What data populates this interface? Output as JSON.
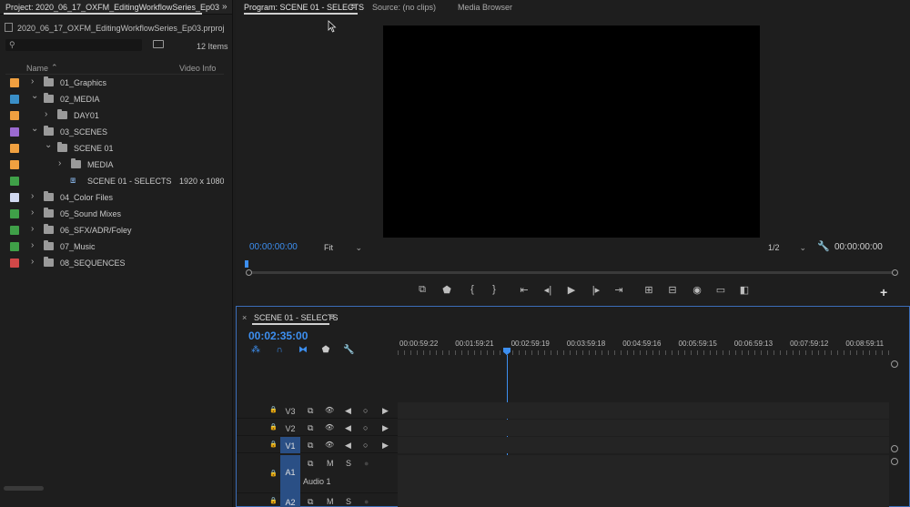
{
  "project": {
    "tab_title": "Project: 2020_06_17_OXFM_EditingWorkflowSeries_Ep03",
    "file_name": "2020_06_17_OXFM_EditingWorkflowSeries_Ep03.prproj",
    "item_count": "12 Items",
    "columns": {
      "name": "Name",
      "video_info": "Video Info"
    },
    "items": [
      {
        "name": "01_Graphics",
        "color": "#f0a040",
        "indent": 0,
        "type": "bin",
        "expanded": false,
        "video_info": ""
      },
      {
        "name": "02_MEDIA",
        "color": "#3a8fc8",
        "indent": 0,
        "type": "bin",
        "expanded": true,
        "video_info": ""
      },
      {
        "name": "DAY01",
        "color": "#f0a040",
        "indent": 1,
        "type": "bin",
        "expanded": false,
        "video_info": ""
      },
      {
        "name": "03_SCENES",
        "color": "#9b6ad0",
        "indent": 0,
        "type": "bin",
        "expanded": true,
        "video_info": ""
      },
      {
        "name": "SCENE 01",
        "color": "#f0a040",
        "indent": 1,
        "type": "bin",
        "expanded": true,
        "video_info": ""
      },
      {
        "name": "MEDIA",
        "color": "#f0a040",
        "indent": 2,
        "type": "bin",
        "expanded": false,
        "video_info": ""
      },
      {
        "name": "SCENE 01 - SELECTS",
        "color": "#3fa048",
        "indent": 2,
        "type": "sequence",
        "expanded": false,
        "video_info": "1920 x 1080 ("
      },
      {
        "name": "04_Color Files",
        "color": "#d0d8f0",
        "indent": 0,
        "type": "bin",
        "expanded": false,
        "video_info": ""
      },
      {
        "name": "05_Sound Mixes",
        "color": "#3fa048",
        "indent": 0,
        "type": "bin",
        "expanded": false,
        "video_info": ""
      },
      {
        "name": "06_SFX/ADR/Foley",
        "color": "#3fa048",
        "indent": 0,
        "type": "bin",
        "expanded": false,
        "video_info": ""
      },
      {
        "name": "07_Music",
        "color": "#3fa048",
        "indent": 0,
        "type": "bin",
        "expanded": false,
        "video_info": ""
      },
      {
        "name": "08_SEQUENCES",
        "color": "#d04848",
        "indent": 0,
        "type": "bin",
        "expanded": false,
        "video_info": ""
      }
    ]
  },
  "monitor": {
    "tabs": {
      "program": "Program: SCENE 01 - SELECTS",
      "source": "Source: (no clips)",
      "media_browser": "Media Browser"
    },
    "playhead_tc": "00:00:00:00",
    "fit": "Fit",
    "resolution": "1/2",
    "duration_tc": "00:00:00:00"
  },
  "timeline": {
    "tab_title": "SCENE 01 - SELECTS",
    "timecode": "00:02:35:00",
    "ruler": [
      "00:00:59:22",
      "00:01:59:21",
      "00:02:59:19",
      "00:03:59:18",
      "00:04:59:16",
      "00:05:59:15",
      "00:06:59:13",
      "00:07:59:12",
      "00:08:59:11"
    ],
    "tracks": [
      {
        "id": "V3",
        "source": "",
        "type": "video"
      },
      {
        "id": "V2",
        "source": "",
        "type": "video"
      },
      {
        "id": "V1",
        "source": "V1",
        "type": "video"
      },
      {
        "id": "A1",
        "source": "A1",
        "type": "audio",
        "name": "Audio 1"
      },
      {
        "id": "A2",
        "source": "A2",
        "type": "audio"
      }
    ],
    "mute_label": "M",
    "solo_label": "S"
  },
  "colors": {
    "accent": "#3d8ff0",
    "panel": "#1e1e1e"
  }
}
